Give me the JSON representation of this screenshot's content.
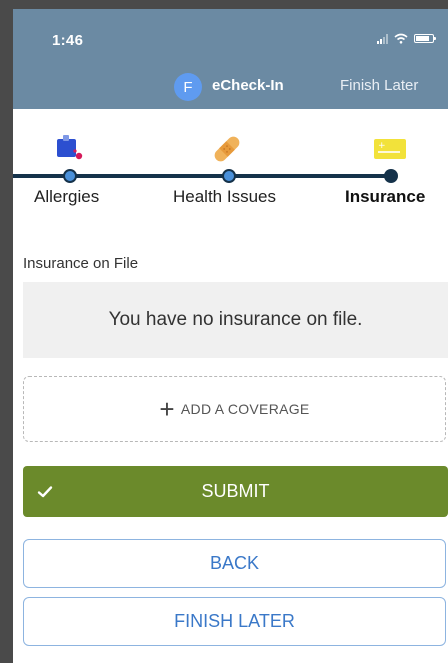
{
  "status_bar": {
    "time": "1:46",
    "icons": [
      "signal-icon",
      "wifi-icon",
      "battery-icon"
    ]
  },
  "nav": {
    "avatar_letter": "F",
    "title": "eCheck-In",
    "finish_later": "Finish Later"
  },
  "steps": [
    {
      "label": "Allergies",
      "icon": "allergy-icon",
      "state": "done"
    },
    {
      "label": "Health Issues",
      "icon": "bandage-icon",
      "state": "done"
    },
    {
      "label": "Insurance",
      "icon": "insurance-card-icon",
      "state": "current"
    }
  ],
  "insurance": {
    "section_label": "Insurance on File",
    "empty_message": "You have no insurance on file.",
    "add_coverage": "ADD A COVERAGE"
  },
  "actions": {
    "submit": "SUBMIT",
    "back": "BACK",
    "finish_later": "FINISH LATER"
  },
  "colors": {
    "header": "#6b8aa3",
    "submit": "#6b8a2b",
    "outline": "#3a78c8",
    "step_line": "#15324a",
    "avatar": "#5f9bf0"
  }
}
